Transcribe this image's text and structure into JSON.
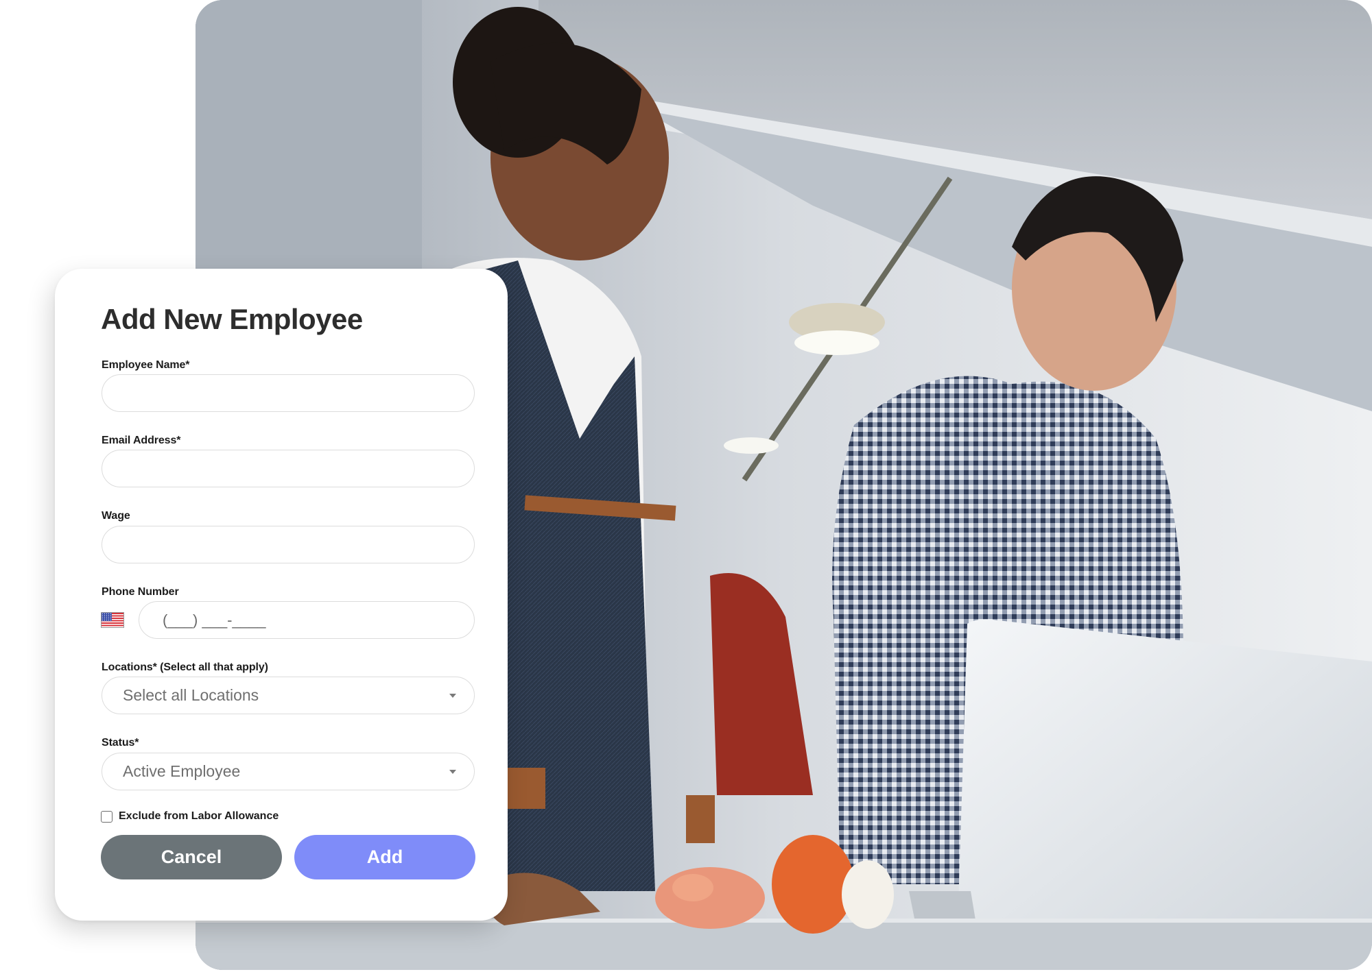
{
  "form": {
    "title": "Add New Employee",
    "fields": {
      "employee_name": {
        "label": "Employee Name*",
        "value": "",
        "placeholder": ""
      },
      "email": {
        "label": "Email Address*",
        "value": "",
        "placeholder": ""
      },
      "wage": {
        "label": "Wage",
        "value": "",
        "placeholder": ""
      },
      "phone": {
        "label": "Phone Number",
        "value": "",
        "placeholder": "(___) ___-____",
        "country_icon": "us-flag-icon"
      },
      "locations": {
        "label": "Locations* (Select all that apply)",
        "selected": "Select all Locations"
      },
      "status": {
        "label": "Status*",
        "selected": "Active Employee"
      }
    },
    "exclude_labor": {
      "label": "Exclude from Labor Allowance",
      "checked": false
    },
    "buttons": {
      "cancel": "Cancel",
      "add": "Add"
    }
  },
  "colors": {
    "cancel_button": "#6b7478",
    "add_button": "#7f8cf9",
    "title_text": "#2d2d2d",
    "input_border": "#dcdcdc"
  },
  "background": {
    "description": "Photo of two food-truck workers smiling over a laptop in a stainless-steel kitchen"
  }
}
